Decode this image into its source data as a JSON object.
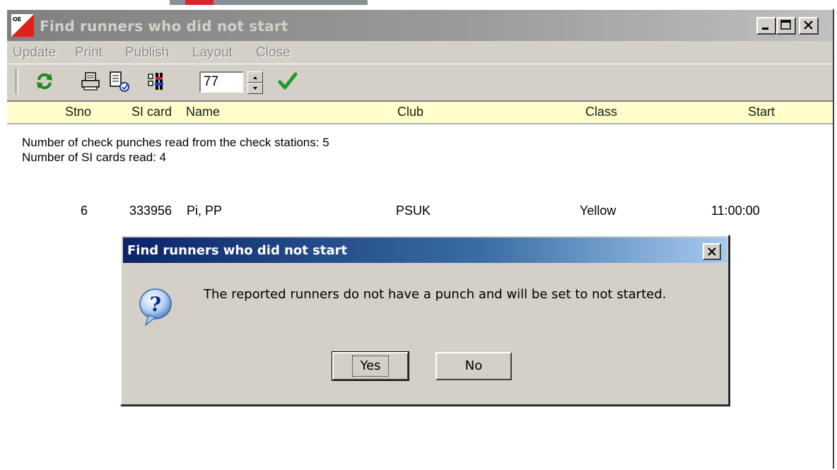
{
  "window": {
    "title": "Find runners who did not start"
  },
  "menu": [
    "Update",
    "Print",
    "Publish",
    "Layout",
    "Close"
  ],
  "toolbar": {
    "icons": [
      "refresh-icon",
      "print-icon",
      "publish-icon",
      "layout-icon",
      "spinner",
      "ok-check-icon"
    ],
    "number_value": "77"
  },
  "table": {
    "headers": [
      "Stno",
      "SI card",
      "Name",
      "Club",
      "Class",
      "Start"
    ],
    "rows": [
      {
        "stno": "6",
        "si_card": "333956",
        "name": "Pi, PP",
        "club": "PSUK",
        "class": "Yellow",
        "start": "11:00:00"
      }
    ]
  },
  "info": {
    "line1": "Number of check punches read from the check stations: 5",
    "line2": "Number of SI cards read: 4"
  },
  "dialog": {
    "title": "Find runners who did not start",
    "message": "The reported runners do not have a punch and will be set to not started.",
    "yes_label": "Yes",
    "no_label": "No"
  },
  "colors": {
    "dialog_title_start": "#0a246a",
    "dialog_title_end": "#a6caf0",
    "header_row": "#ffffcc",
    "window_face": "#d4d0c8"
  }
}
